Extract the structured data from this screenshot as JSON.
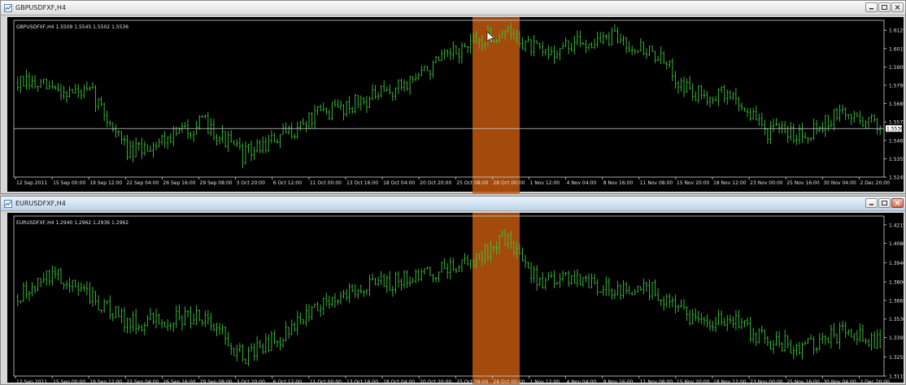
{
  "colors": {
    "background": "#000000",
    "bars": "#3ec43e",
    "highlight": "#c0580e",
    "grid": "#cfcfcf",
    "text": "#e0e0e0"
  },
  "windows": [
    {
      "title": "GBPUSDFXF,H4",
      "ohlc": "GBPUSDFXF,H4  1.5509 1.5545 1.5502 1.5536",
      "price_levels": [
        "1.6125",
        "1.6015",
        "1.5905",
        "1.5795",
        "1.5685",
        "1.5575",
        "1.5465",
        "1.5355",
        "1.5245"
      ],
      "current_price": "1.5536",
      "dates": [
        "12 Sep 2011",
        "15 Sep 00:00",
        "19 Sep 12:00",
        "22 Sep 04:00",
        "26 Sep 16:00",
        "29 Sep 08:00",
        "3 Oct 20:00",
        "6 Oct 12:00",
        "11 Oct 00:00",
        "13 Oct 16:00",
        "18 Oct 04:00",
        "20 Oct 20:00",
        "25 Oct 08:00",
        "28 Oct 00:00",
        "1 Nov 12:00",
        "4 Nov 04:00",
        "8 Nov 16:00",
        "11 Nov 08:00",
        "15 Nov 20:00",
        "18 Nov 12:00",
        "23 Nov 00:00",
        "25 Nov 16:00",
        "30 Nov 04:00",
        "2 Dec 20:00"
      ],
      "chart_data": {
        "type": "bar",
        "title": "GBPUSDFXF,H4",
        "ylim": [
          1.5245,
          1.6165
        ],
        "x": [
          "12 Sep 2011",
          "15 Sep 00:00",
          "19 Sep 12:00",
          "22 Sep 04:00",
          "26 Sep 16:00",
          "29 Sep 08:00",
          "3 Oct 20:00",
          "6 Oct 12:00",
          "11 Oct 00:00",
          "13 Oct 16:00",
          "18 Oct 04:00",
          "20 Oct 20:00",
          "25 Oct 08:00",
          "28 Oct 00:00",
          "1 Nov 12:00",
          "4 Nov 04:00",
          "8 Nov 16:00",
          "11 Nov 08:00",
          "15 Nov 20:00",
          "18 Nov 12:00",
          "23 Nov 00:00",
          "25 Nov 16:00",
          "30 Nov 04:00",
          "2 Dec 20:00"
        ],
        "series": [
          {
            "values": [
              1.581,
              1.577,
              1.574,
              1.538,
              1.549,
              1.557,
              1.538,
              1.548,
              1.562,
              1.569,
              1.576,
              1.59,
              1.603,
              1.612,
              1.598,
              1.605,
              1.608,
              1.598,
              1.574,
              1.574,
              1.552,
              1.551,
              1.563,
              1.556
            ]
          }
        ],
        "current_value": 1.5536
      }
    },
    {
      "title": "EURUSDFXF,H4",
      "ohlc": "EURUSDFXF,H4  1.2940 1.2962 1.2936 1.2962",
      "price_levels": [
        "1.4215",
        "1.4080",
        "1.3940",
        "1.3800",
        "1.3665",
        "1.3530",
        "1.3395",
        "1.3255",
        "1.3115"
      ],
      "dates": [
        "12 Sep 2011",
        "15 Sep 00:00",
        "19 Sep 12:00",
        "22 Sep 04:00",
        "26 Sep 16:00",
        "29 Sep 08:00",
        "3 Oct 20:00",
        "6 Oct 12:00",
        "11 Oct 00:00",
        "13 Oct 16:00",
        "18 Oct 04:00",
        "20 Oct 20:00",
        "25 Oct 08:00",
        "28 Oct 00:00",
        "1 Nov 12:00",
        "4 Nov 04:00",
        "8 Nov 16:00",
        "11 Nov 08:00",
        "15 Nov 20:00",
        "18 Nov 12:00",
        "23 Nov 00:00",
        "25 Nov 16:00",
        "30 Nov 04:00",
        "2 Dec 20:00"
      ],
      "chart_data": {
        "type": "bar",
        "title": "EURUSDFXF,H4",
        "ylim": [
          1.3115,
          1.4255
        ],
        "x": [
          "12 Sep 2011",
          "15 Sep 00:00",
          "19 Sep 12:00",
          "22 Sep 04:00",
          "26 Sep 16:00",
          "29 Sep 08:00",
          "3 Oct 20:00",
          "6 Oct 12:00",
          "11 Oct 00:00",
          "13 Oct 16:00",
          "18 Oct 04:00",
          "20 Oct 20:00",
          "25 Oct 08:00",
          "28 Oct 00:00",
          "1 Nov 12:00",
          "4 Nov 04:00",
          "8 Nov 16:00",
          "11 Nov 08:00",
          "15 Nov 20:00",
          "18 Nov 12:00",
          "23 Nov 00:00",
          "25 Nov 16:00",
          "30 Nov 04:00",
          "2 Dec 20:00"
        ],
        "series": [
          {
            "values": [
              1.369,
              1.386,
              1.367,
              1.35,
              1.353,
              1.356,
              1.325,
              1.34,
              1.363,
              1.375,
              1.38,
              1.386,
              1.394,
              1.412,
              1.378,
              1.383,
              1.372,
              1.374,
              1.352,
              1.352,
              1.337,
              1.332,
              1.343,
              1.336
            ]
          }
        ]
      }
    }
  ]
}
